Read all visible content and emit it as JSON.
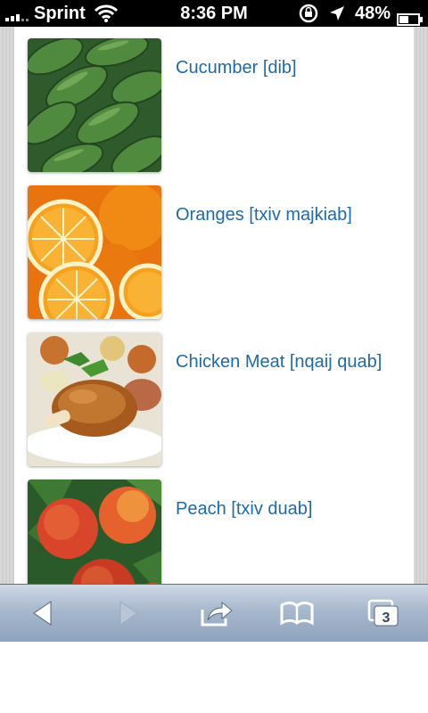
{
  "status_bar": {
    "carrier": "Sprint",
    "time": "8:36 PM",
    "battery_percent": "48%",
    "icons": [
      "signal-icon",
      "wifi-icon",
      "rotation-lock-icon",
      "location-icon",
      "battery-icon"
    ]
  },
  "items": [
    {
      "label": "Cucumber [dib]",
      "icon": "cucumber-image"
    },
    {
      "label": "Oranges [txiv majkiab]",
      "icon": "oranges-image"
    },
    {
      "label": "Chicken Meat [nqaij quab]",
      "icon": "chicken-image"
    },
    {
      "label": "Peach [txiv duab]",
      "icon": "peach-image"
    }
  ],
  "toolbar": {
    "buttons": [
      "back-icon",
      "forward-icon",
      "share-icon",
      "bookmarks-icon",
      "tabs-icon"
    ],
    "tabs_count": "3"
  },
  "colors": {
    "link": "#1f6aa8",
    "toolbar": "#a7b8cd"
  }
}
